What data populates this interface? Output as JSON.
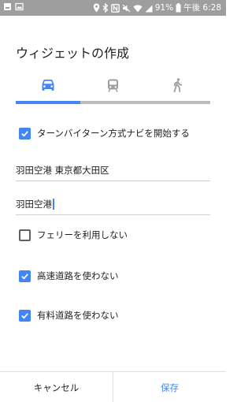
{
  "status_bar": {
    "battery_percent": "91%",
    "time": "午後 6:28",
    "icons": [
      "notification-icon",
      "image-icon",
      "location-icon",
      "bluetooth-icon",
      "nfc-icon",
      "mute-icon",
      "wifi-icon",
      "signal-icon",
      "battery-icon"
    ]
  },
  "dialog": {
    "title": "ウィジェットの作成",
    "tabs": [
      {
        "icon": "car-icon",
        "selected": true
      },
      {
        "icon": "transit-icon",
        "selected": false
      },
      {
        "icon": "walk-icon",
        "selected": false
      }
    ],
    "turn_by_turn": {
      "label": "ターンバイターン方式ナビを開始する",
      "checked": true
    },
    "destination_field": {
      "value": "羽田空港 東京都大田区"
    },
    "shortcut_name_field": {
      "value": "羽田空港"
    },
    "options": [
      {
        "label": "フェリーを利用しない",
        "checked": false
      },
      {
        "label": "高速道路を使わない",
        "checked": true
      },
      {
        "label": "有料道路を使わない",
        "checked": true
      }
    ],
    "cancel_label": "キャンセル",
    "save_label": "保存"
  },
  "colors": {
    "accent": "#4285f4",
    "status_bar": "#9e9e9e",
    "inactive_icon": "#9e9e9e"
  }
}
